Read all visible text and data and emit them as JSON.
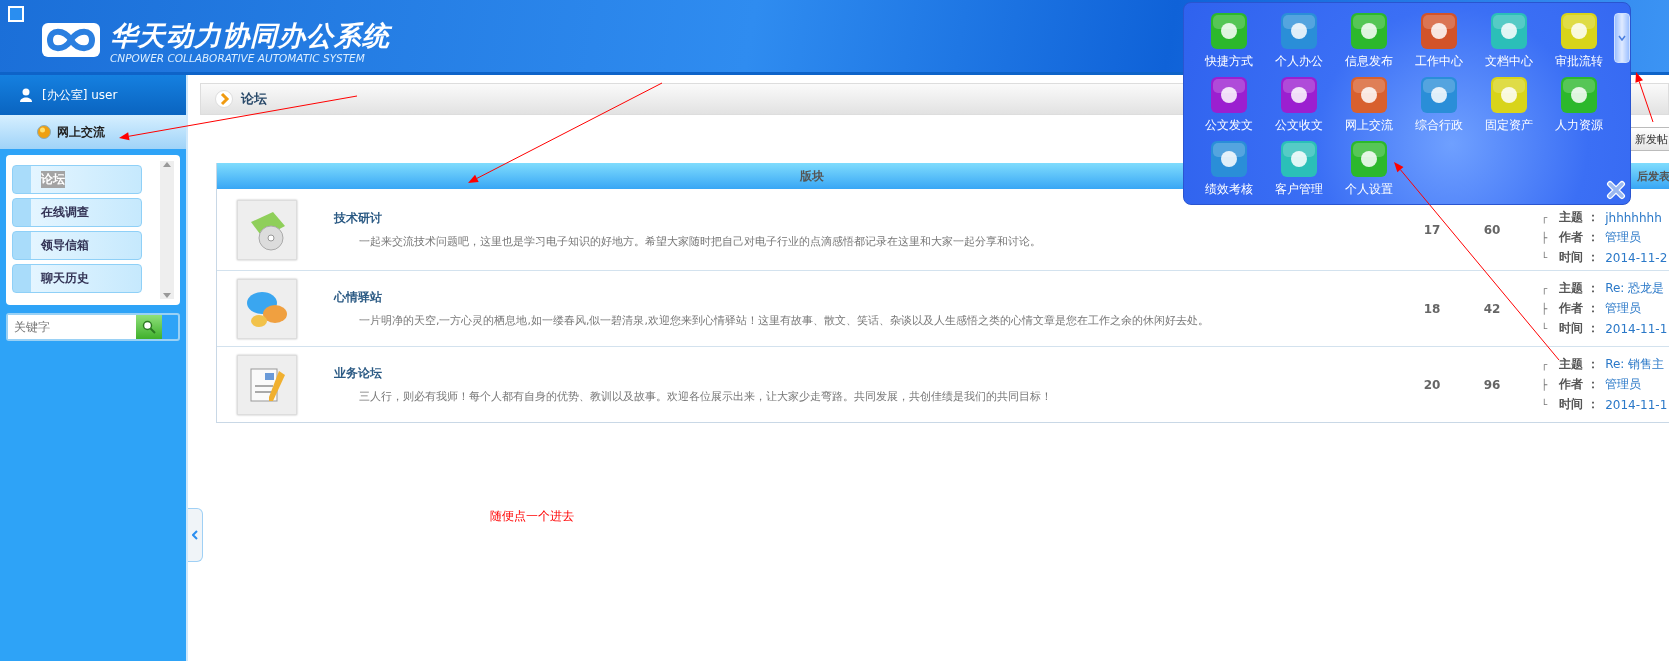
{
  "header": {
    "title": "华天动力协同办公系统",
    "subtitle": "CNPOWER COLLABORATIVE AUTOMATIC SYSTEM"
  },
  "sidebar": {
    "user": "[办公室] user",
    "section": "网上交流",
    "items": [
      {
        "label": "论坛",
        "selected": true
      },
      {
        "label": "在线调查",
        "selected": false
      },
      {
        "label": "领导信箱",
        "selected": false
      },
      {
        "label": "聊天历史",
        "selected": false
      }
    ],
    "search": {
      "placeholder": "关键字"
    }
  },
  "page_title": "论坛",
  "new_post_button": "新发帖",
  "table": {
    "columns": [
      "版块",
      "后发表"
    ],
    "rows": [
      {
        "kind": "disc",
        "title": "技术研讨",
        "description": "一起来交流技术问题吧，这里也是学习电子知识的好地方。希望大家随时把自己对电子行业的点滴感悟都记录在这里和大家一起分享和讨论。",
        "topics": "17",
        "posts": "60",
        "last_post": [
          {
            "mark": "┌",
            "label": "主题 ：",
            "value": "jhhhhhhh"
          },
          {
            "mark": "├",
            "label": "作者 ：",
            "value": "管理员"
          },
          {
            "mark": "└",
            "label": "时间 ：",
            "value": "2014-11-2"
          }
        ]
      },
      {
        "kind": "chat",
        "title": "心情驿站",
        "description": "一片明净的天空,一方心灵的栖息地,如一缕春风,似一碧清泉,欢迎您来到心情驿站！这里有故事、散文、笑话、杂谈以及人生感悟之类的心情文章是您在工作之余的休闲好去处。",
        "topics": "18",
        "posts": "42",
        "last_post": [
          {
            "mark": "┌",
            "label": "主题 ：",
            "value": "Re: 恐龙是"
          },
          {
            "mark": "├",
            "label": "作者 ：",
            "value": "管理员"
          },
          {
            "mark": "└",
            "label": "时间 ：",
            "value": "2014-11-1"
          }
        ]
      },
      {
        "kind": "document",
        "title": "业务论坛",
        "description": "三人行，则必有我师！每个人都有自身的优势、教训以及故事。欢迎各位展示出来，让大家少走弯路。共同发展，共创佳绩是我们的共同目标！",
        "topics": "20",
        "posts": "96",
        "last_post": [
          {
            "mark": "┌",
            "label": "主题 ：",
            "value": "Re: 销售主"
          },
          {
            "mark": "├",
            "label": "作者 ：",
            "value": "管理员"
          },
          {
            "mark": "└",
            "label": "时间 ：",
            "value": "2014-11-1"
          }
        ]
      }
    ]
  },
  "quick_menu": {
    "items": [
      {
        "label": "快捷方式",
        "color": "#2cb82c"
      },
      {
        "label": "个人办公",
        "color": "#2a8ed8"
      },
      {
        "label": "信息发布",
        "color": "#2cb82c"
      },
      {
        "label": "工作中心",
        "color": "#d2532a"
      },
      {
        "label": "文档中心",
        "color": "#2bbfb8"
      },
      {
        "label": "审批流转",
        "color": "#d8d41a"
      },
      {
        "label": "公文发文",
        "color": "#9b1fd0"
      },
      {
        "label": "公文收文",
        "color": "#9b1fd0"
      },
      {
        "label": "网上交流",
        "color": "#d8602e"
      },
      {
        "label": "综合行政",
        "color": "#2a8ed8"
      },
      {
        "label": "固定资产",
        "color": "#d8d41a"
      },
      {
        "label": "人力资源",
        "color": "#2cb82c"
      },
      {
        "label": "绩效考核",
        "color": "#2a8ed8"
      },
      {
        "label": "客户管理",
        "color": "#2bbfb8"
      },
      {
        "label": "个人设置",
        "color": "#2cb82c"
      }
    ]
  },
  "annotation": "随便点一个进去"
}
